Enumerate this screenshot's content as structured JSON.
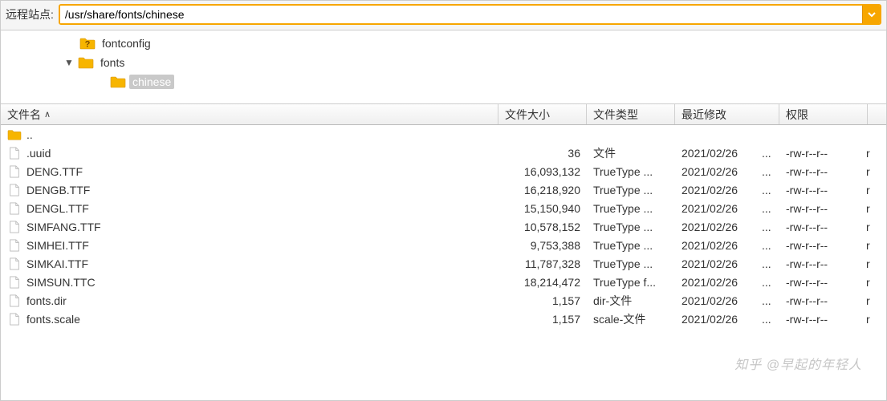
{
  "path_bar": {
    "label": "远程站点:",
    "value": "/usr/share/fonts/chinese"
  },
  "tree": {
    "items": [
      {
        "icon": "question-folder",
        "label": "fontconfig",
        "level": 1,
        "expanded": null
      },
      {
        "icon": "folder",
        "label": "fonts",
        "level": 1,
        "expanded": true
      },
      {
        "icon": "folder",
        "label": "chinese",
        "level": 2,
        "expanded": null,
        "selected": true
      }
    ]
  },
  "columns": {
    "name": "文件名",
    "size": "文件大小",
    "type": "文件类型",
    "date": "最近修改",
    "perm": "权限"
  },
  "files": [
    {
      "name": "..",
      "icon": "folder-up",
      "size": "",
      "type": "",
      "date": "",
      "dots": "",
      "perm": "",
      "more": ""
    },
    {
      "name": ".uuid",
      "icon": "file",
      "size": "36",
      "type": "文件",
      "date": "2021/02/26",
      "dots": "...",
      "perm": "-rw-r--r--",
      "more": "r"
    },
    {
      "name": "DENG.TTF",
      "icon": "file",
      "size": "16,093,132",
      "type": "TrueType ...",
      "date": "2021/02/26",
      "dots": "...",
      "perm": "-rw-r--r--",
      "more": "r"
    },
    {
      "name": "DENGB.TTF",
      "icon": "file",
      "size": "16,218,920",
      "type": "TrueType ...",
      "date": "2021/02/26",
      "dots": "...",
      "perm": "-rw-r--r--",
      "more": "r"
    },
    {
      "name": "DENGL.TTF",
      "icon": "file",
      "size": "15,150,940",
      "type": "TrueType ...",
      "date": "2021/02/26",
      "dots": "...",
      "perm": "-rw-r--r--",
      "more": "r"
    },
    {
      "name": "SIMFANG.TTF",
      "icon": "file",
      "size": "10,578,152",
      "type": "TrueType ...",
      "date": "2021/02/26",
      "dots": "...",
      "perm": "-rw-r--r--",
      "more": "r"
    },
    {
      "name": "SIMHEI.TTF",
      "icon": "file",
      "size": "9,753,388",
      "type": "TrueType ...",
      "date": "2021/02/26",
      "dots": "...",
      "perm": "-rw-r--r--",
      "more": "r"
    },
    {
      "name": "SIMKAI.TTF",
      "icon": "file",
      "size": "11,787,328",
      "type": "TrueType ...",
      "date": "2021/02/26",
      "dots": "...",
      "perm": "-rw-r--r--",
      "more": "r"
    },
    {
      "name": "SIMSUN.TTC",
      "icon": "file",
      "size": "18,214,472",
      "type": "TrueType f...",
      "date": "2021/02/26",
      "dots": "...",
      "perm": "-rw-r--r--",
      "more": "r"
    },
    {
      "name": "fonts.dir",
      "icon": "file",
      "size": "1,157",
      "type": "dir-文件",
      "date": "2021/02/26",
      "dots": "...",
      "perm": "-rw-r--r--",
      "more": "r"
    },
    {
      "name": "fonts.scale",
      "icon": "file",
      "size": "1,157",
      "type": "scale-文件",
      "date": "2021/02/26",
      "dots": "...",
      "perm": "-rw-r--r--",
      "more": "r"
    }
  ],
  "watermark": "知乎 @早起的年轻人"
}
